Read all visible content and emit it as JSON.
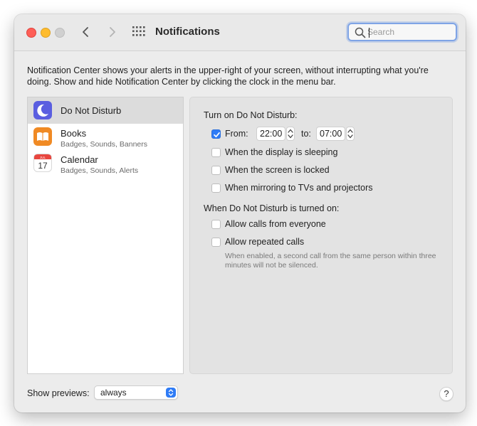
{
  "window": {
    "title": "Notifications",
    "search": {
      "placeholder": "Search",
      "value": ""
    }
  },
  "description": "Notification Center shows your alerts in the upper-right of your screen, without interrupting what you're doing. Show and hide Notification Center by clicking the clock in the menu bar.",
  "sidebar": {
    "items": [
      {
        "name": "Do Not Disturb",
        "subtitle": "",
        "icon": "moon-icon",
        "selected": true
      },
      {
        "name": "Books",
        "subtitle": "Badges, Sounds, Banners",
        "icon": "books-icon",
        "selected": false
      },
      {
        "name": "Calendar",
        "subtitle": "Badges, Sounds, Alerts",
        "icon": "calendar-icon",
        "selected": false
      }
    ],
    "calendar_icon": {
      "month": "JUL",
      "day": "17"
    }
  },
  "dnd": {
    "section1_heading": "Turn on Do Not Disturb:",
    "from_label": "From:",
    "from_checked": true,
    "from_time": "22:00",
    "to_label": "to:",
    "to_time": "07:00",
    "options1": [
      {
        "label": "When the display is sleeping",
        "checked": false
      },
      {
        "label": "When the screen is locked",
        "checked": false
      },
      {
        "label": "When mirroring to TVs and projectors",
        "checked": false
      }
    ],
    "section2_heading": "When Do Not Disturb is turned on:",
    "options2": [
      {
        "label": "Allow calls from everyone",
        "checked": false
      },
      {
        "label": "Allow repeated calls",
        "checked": false
      }
    ],
    "note": "When enabled, a second call from the same person within three minutes will not be silenced."
  },
  "footer": {
    "previews_label": "Show previews:",
    "previews_value": "always",
    "help": "?"
  },
  "colors": {
    "accent": "#2f7cf6",
    "traffic_red": "#fe5f57",
    "traffic_yellow": "#febc2e",
    "traffic_inactive": "#d0d0d0"
  }
}
